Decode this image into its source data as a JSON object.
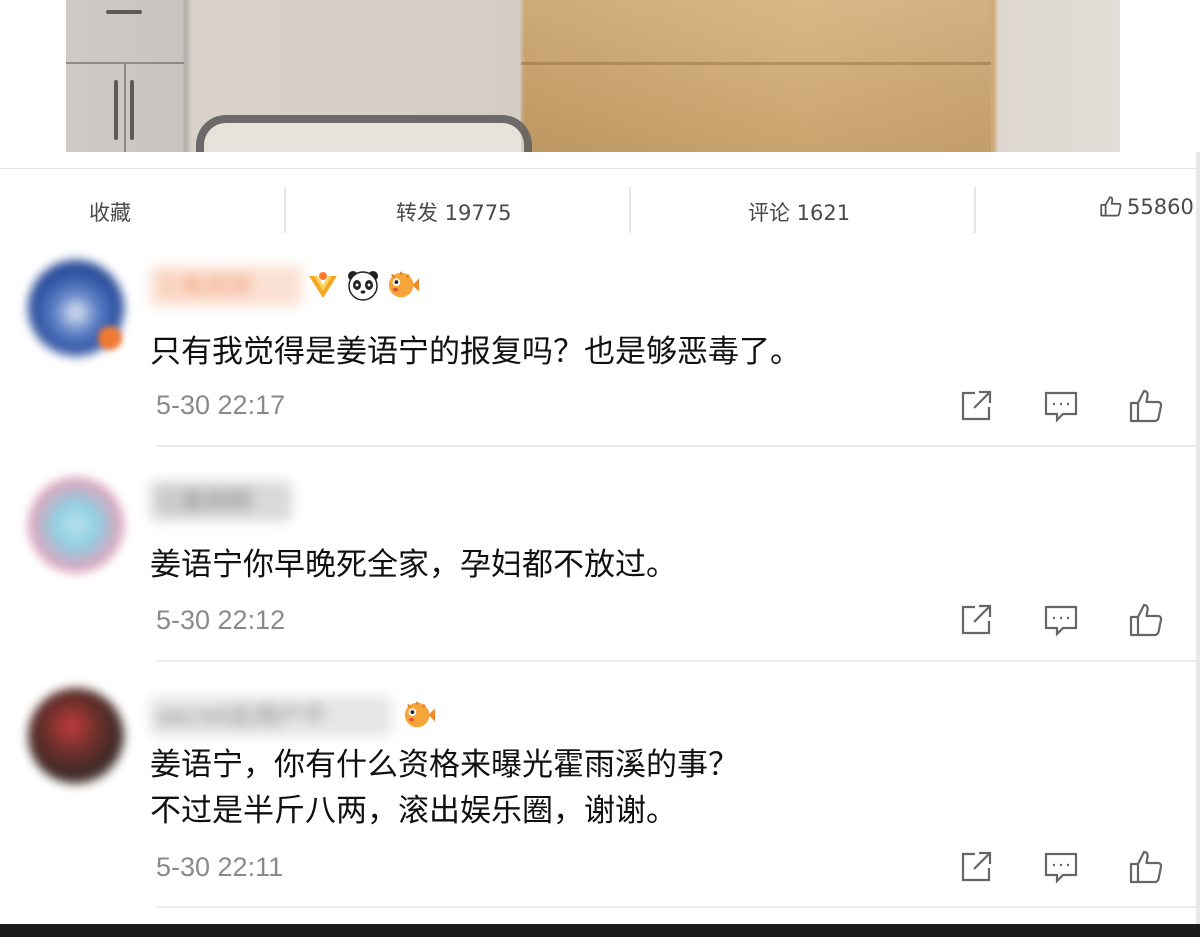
{
  "actions": {
    "favorite_label": "收藏",
    "repost_label": "转发 19775",
    "comment_label": "评论 1621",
    "like_count": "55860"
  },
  "comments": [
    {
      "username": "三角顽顽",
      "text_lines": [
        "只有我觉得是姜语宁的报复吗？也是够恶毒了。"
      ],
      "time": "5-30 22:17",
      "badges": [
        "vip-medal-icon",
        "panda-emoji-icon",
        "pufferfish-emoji-icon"
      ]
    },
    {
      "username": "三童桐桐",
      "text_lines": [
        "姜语宁你早晚死全家，孕妇都不放过。"
      ],
      "time": "5-30 22:12",
      "badges": []
    },
    {
      "username": "secret此用户不",
      "text_lines": [
        "姜语宁，你有什么资格来曝光霍雨溪的事？",
        "不过是半斤八两，滚出娱乐圈，谢谢。"
      ],
      "time": "5-30 22:11",
      "badges": [
        "pufferfish-emoji-icon"
      ]
    }
  ],
  "colors": {
    "text": "#111111",
    "meta": "#8a8a8a",
    "divider": "#ebebeb",
    "bottom_bar": "#1a1a1a"
  }
}
